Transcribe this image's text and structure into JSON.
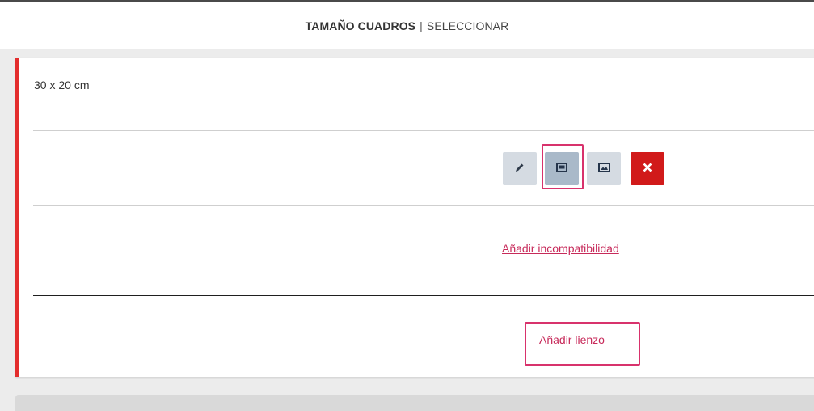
{
  "header": {
    "title": "TAMAÑO CUADROS",
    "separator": "|",
    "subtitle": "SELECCIONAR"
  },
  "item": {
    "size_label": "30 x 20 cm",
    "actions": [
      {
        "name": "edit",
        "icon": "pencil-icon"
      },
      {
        "name": "image-select",
        "icon": "image-select-icon"
      },
      {
        "name": "image",
        "icon": "image-icon"
      },
      {
        "name": "delete",
        "icon": "close-icon"
      }
    ],
    "add_incompatibility_label": "Añadir incompatibilidad",
    "add_canvas_label": "Añadir lienzo"
  },
  "colors": {
    "accent_red": "#e32d2d",
    "delete_red": "#d11a1a",
    "link_pink": "#c72a5a",
    "highlight": "#d8326c"
  }
}
